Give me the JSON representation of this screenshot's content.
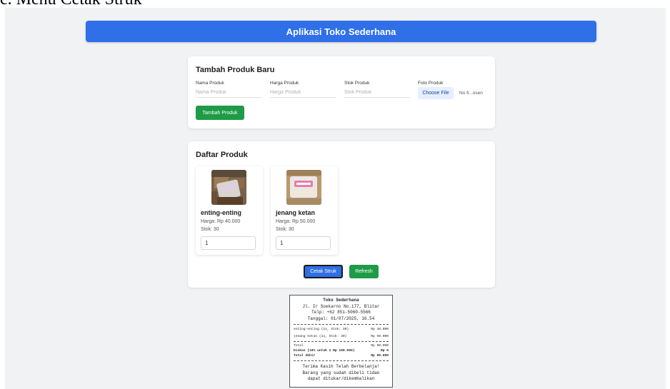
{
  "doc_heading": "c. Menu Cetak Struk",
  "header": {
    "title": "Aplikasi Toko Sederhana"
  },
  "add_product": {
    "title": "Tambah Produk Baru",
    "fields": [
      {
        "label": "Nama Produk",
        "placeholder": "Nama Produk"
      },
      {
        "label": "Harga Produk",
        "placeholder": "Harga Produk"
      },
      {
        "label": "Stok Produk",
        "placeholder": "Stok Produk"
      },
      {
        "label": "Foto Produk"
      }
    ],
    "choose_file_label": "Choose File",
    "no_file_text": "No fi...osen",
    "submit_label": "Tambah Produk"
  },
  "product_list": {
    "title": "Daftar Produk",
    "items": [
      {
        "name": "enting-enting",
        "price": "Harga: Rp 40.000",
        "stock": "Stok: 30",
        "qty": "1"
      },
      {
        "name": "jenang ketan",
        "price": "Harga: Rp 50.000",
        "stock": "Stok: 30",
        "qty": "1"
      }
    ],
    "print_label": "Cetak Struk",
    "refresh_label": "Refresh"
  },
  "receipt": {
    "store_name": "Toko Sederhana",
    "address": "Jl. Ir Soekarno No.177, Blitar",
    "phone": "Telp: +62 851-5060-5566",
    "date": "Tanggal: 01/07/2025, 16.54",
    "items": [
      {
        "desc": "enting-enting (1x, Stok: 30)",
        "amount": "Rp 40.000"
      },
      {
        "desc": "jenang ketan (1x, Stok: 30)",
        "amount": "Rp 50.000"
      }
    ],
    "total": {
      "label": "Total",
      "value": "Rp 90.000"
    },
    "discount": {
      "label": "Diskon (10% untuk ≥ Rp 100.000)",
      "value": "Rp 0"
    },
    "grand_total": {
      "label": "Total Akhir",
      "value": "Rp 90.000"
    },
    "footer1": "Terima Kasih Telah Berbelanja!",
    "footer2": "Barang yang sudah dibeli tidak",
    "footer3": "dapat ditukar/dikembalikan"
  },
  "colors": {
    "primary": "#2f6fe8",
    "success": "#1e9b46",
    "background": "#f1f2f4"
  }
}
